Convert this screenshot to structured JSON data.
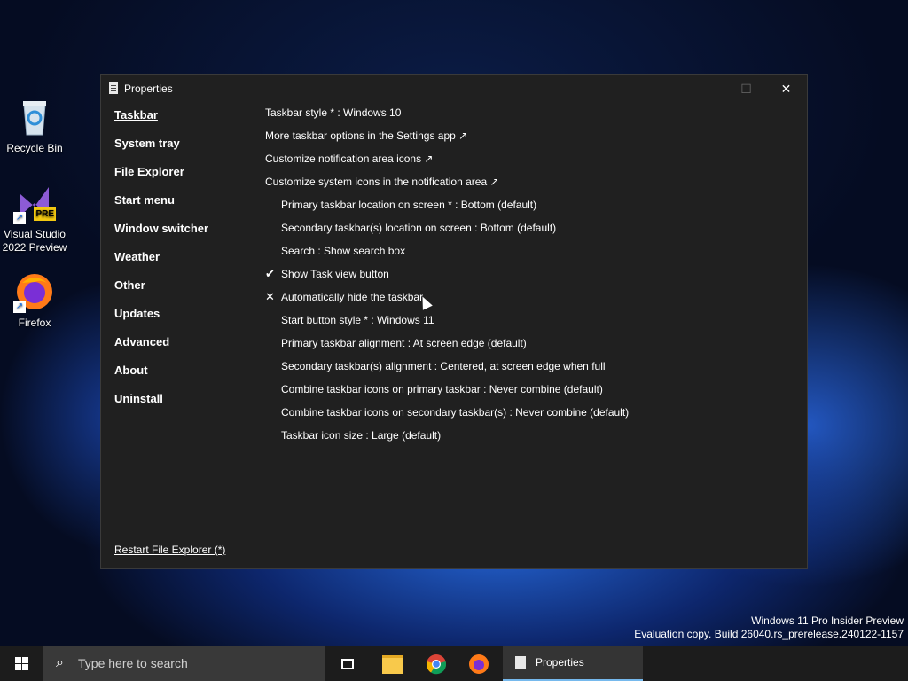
{
  "desktop": {
    "icons": [
      {
        "label": "Recycle Bin"
      },
      {
        "label": "Visual Studio 2022 Preview",
        "badge": "PRE"
      },
      {
        "label": "Firefox"
      }
    ],
    "watermark": {
      "line1": "Windows 11 Pro Insider Preview",
      "line2": "Evaluation copy. Build 26040.rs_prerelease.240122-1157"
    }
  },
  "window": {
    "title": "Properties",
    "controls": {
      "minimize": "—",
      "maximize": "☐",
      "close": "✕"
    },
    "nav": [
      {
        "label": "Taskbar",
        "active": true
      },
      {
        "label": "System tray"
      },
      {
        "label": "File Explorer"
      },
      {
        "label": "Start menu"
      },
      {
        "label": "Window switcher"
      },
      {
        "label": "Weather"
      },
      {
        "label": "Other"
      },
      {
        "label": "Updates"
      },
      {
        "label": "Advanced"
      },
      {
        "label": "About"
      },
      {
        "label": "Uninstall"
      }
    ],
    "restart_link": "Restart File Explorer (*)",
    "options": [
      {
        "text": "Taskbar style * : Windows 10",
        "indent": false,
        "mark": ""
      },
      {
        "text": "More taskbar options in the Settings app ↗",
        "indent": false,
        "mark": ""
      },
      {
        "text": "Customize notification area icons ↗",
        "indent": false,
        "mark": ""
      },
      {
        "text": "Customize system icons in the notification area ↗",
        "indent": false,
        "mark": ""
      },
      {
        "text": "Primary taskbar location on screen * : Bottom (default)",
        "indent": true,
        "mark": ""
      },
      {
        "text": "Secondary taskbar(s) location on screen : Bottom (default)",
        "indent": true,
        "mark": ""
      },
      {
        "text": "Search : Show search box",
        "indent": true,
        "mark": ""
      },
      {
        "text": "Show Task view button",
        "indent": true,
        "mark": "✔"
      },
      {
        "text": "Automatically hide the taskbar",
        "indent": true,
        "mark": "✕"
      },
      {
        "text": "Start button style * : Windows 11",
        "indent": true,
        "mark": ""
      },
      {
        "text": "Primary taskbar alignment : At screen edge (default)",
        "indent": true,
        "mark": ""
      },
      {
        "text": "Secondary taskbar(s) alignment : Centered, at screen edge when full",
        "indent": true,
        "mark": ""
      },
      {
        "text": "Combine taskbar icons on primary taskbar : Never combine (default)",
        "indent": true,
        "mark": ""
      },
      {
        "text": "Combine taskbar icons on secondary taskbar(s) : Never combine (default)",
        "indent": true,
        "mark": ""
      },
      {
        "text": "Taskbar icon size : Large (default)",
        "indent": true,
        "mark": ""
      }
    ]
  },
  "taskbar": {
    "search_placeholder": "Type here to search",
    "active_app": "Properties",
    "pinned": [
      "task-view",
      "file-explorer",
      "chrome",
      "firefox"
    ]
  }
}
